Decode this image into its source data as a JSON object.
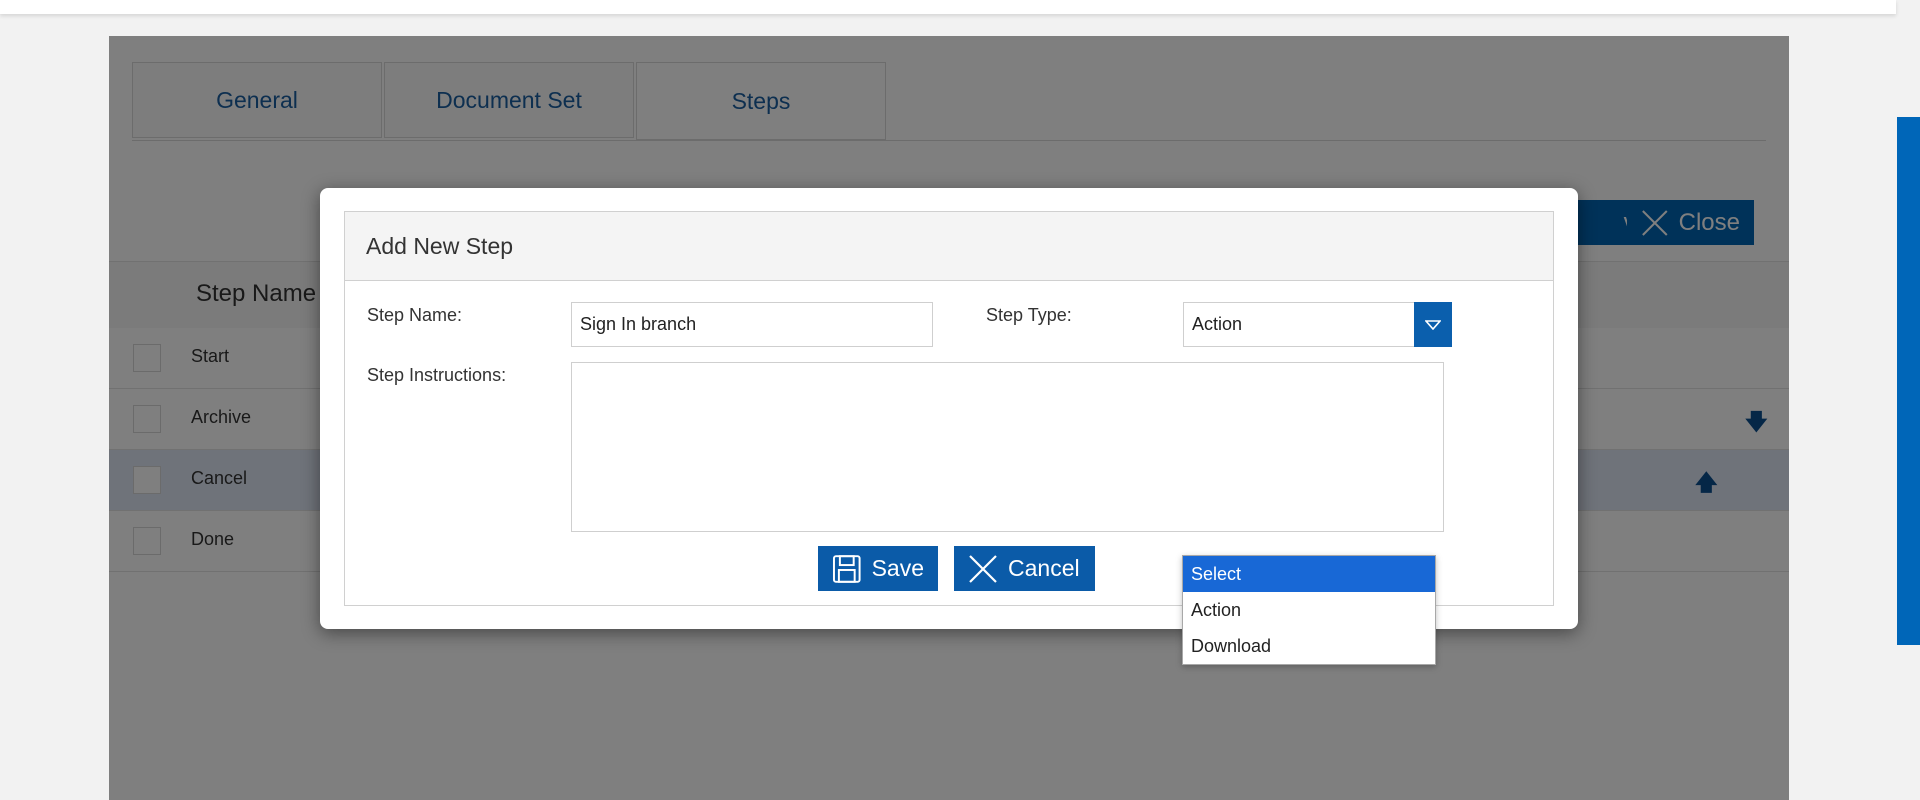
{
  "tabs": [
    "General",
    "Document Set",
    "Steps"
  ],
  "background_buttons": {
    "save_label": "ve",
    "close_label": "Close"
  },
  "table": {
    "header": "Step Name",
    "rows": [
      {
        "label": "Start",
        "arrow": "",
        "selected": false
      },
      {
        "label": "Archive",
        "arrow": "down",
        "selected": false
      },
      {
        "label": "Cancel",
        "arrow": "up",
        "selected": true
      },
      {
        "label": "Done",
        "arrow": "",
        "selected": false
      }
    ]
  },
  "dialog": {
    "title": "Add New Step",
    "step_name_label": "Step Name:",
    "step_name_value": "Sign In branch",
    "step_type_label": "Step Type:",
    "step_type_value": "Action",
    "instructions_label": "Step Instructions:",
    "instructions_value": "",
    "save_label": "Save",
    "cancel_label": "Cancel"
  },
  "dropdown": {
    "options": [
      "Select",
      "Action",
      "Download"
    ],
    "highlighted": "Select"
  },
  "colors": {
    "accent": "#0b5ba8",
    "highlight": "#1868d6",
    "selected_row": "#dfe6f5"
  }
}
